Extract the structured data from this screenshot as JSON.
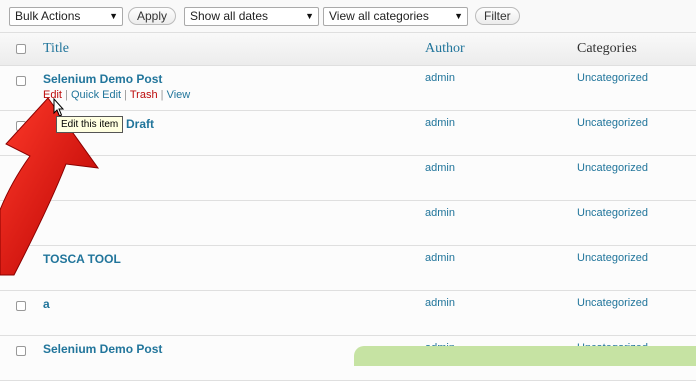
{
  "toolbar": {
    "bulk_actions": "Bulk Actions",
    "apply": "Apply",
    "dates": "Show all dates",
    "categories": "View all categories",
    "filter": "Filter"
  },
  "columns": {
    "title": "Title",
    "author": "Author",
    "categories": "Categories"
  },
  "rows": [
    {
      "title": "Selenium Demo Post",
      "author": "admin",
      "category": "Uncategorized",
      "actions": {
        "edit": "Edit",
        "quick_edit": "Quick Edit",
        "trash": "Trash",
        "view": "View"
      }
    },
    {
      "title": "Draft",
      "author": "admin",
      "category": "Uncategorized"
    },
    {
      "title": "",
      "author": "admin",
      "category": "Uncategorized"
    },
    {
      "title": "",
      "author": "admin",
      "category": "Uncategorized"
    },
    {
      "title": "TOSCA TOOL",
      "author": "admin",
      "category": "Uncategorized"
    },
    {
      "title": "a",
      "author": "admin",
      "category": "Uncategorized"
    },
    {
      "title": "Selenium Demo Post",
      "author": "admin",
      "category": "Uncategorized"
    }
  ],
  "tooltip": "Edit this item",
  "colors": {
    "link": "#21759b",
    "danger": "#bc0b0b",
    "arrow": "#d40000",
    "banner": "#c6e3a3"
  },
  "icons": {
    "cursor": "mouse-pointer-icon",
    "arrow": "annotation-arrow-icon"
  }
}
